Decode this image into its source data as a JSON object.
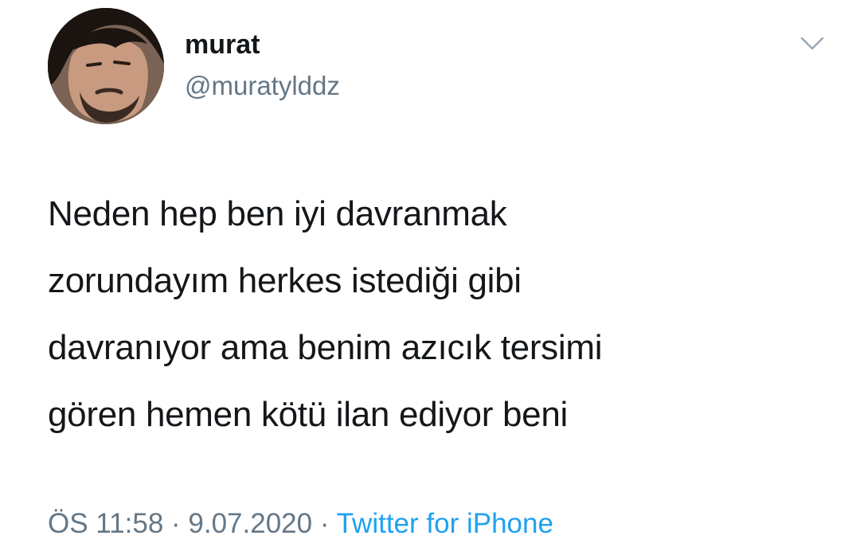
{
  "tweet": {
    "author": {
      "name": "murat",
      "handle": "@muratylddz"
    },
    "text": "Neden hep ben iyi davranmak\nzorundayım herkes istediği gibi\ndavranıyor ama benim azıcık tersimi\ngören hemen kötü ilan ediyor beni",
    "time": "ÖS 11:58",
    "separator": " · ",
    "date": "9.07.2020",
    "source": "Twitter for iPhone",
    "menu_icon": "chevron-down-icon",
    "avatar_icon": "avatar"
  },
  "colors": {
    "text": "#14171a",
    "secondary": "#657786",
    "link": "#1da1f2",
    "background": "#ffffff"
  }
}
